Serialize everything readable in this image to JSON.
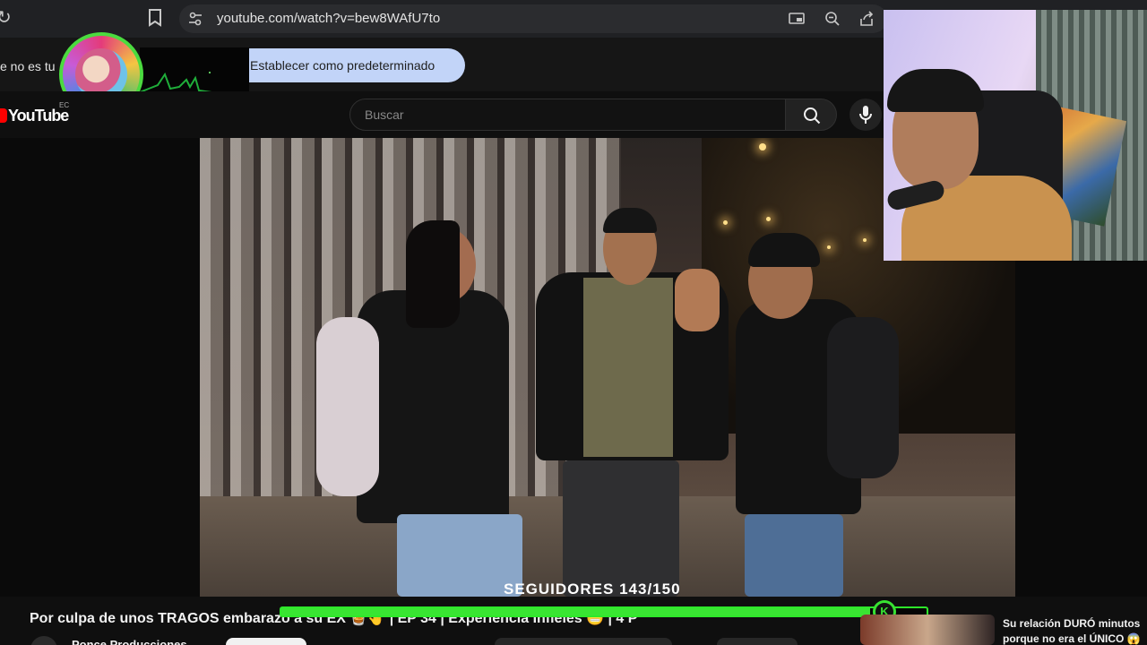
{
  "browser": {
    "url": "youtube.com/watch?v=bew8WAfU7to",
    "icons": [
      "reload-icon",
      "bookmark-icon",
      "tune-icon",
      "cast-icon",
      "zoom-out-icon",
      "share-icon"
    ]
  },
  "notification": {
    "text": "e no es tu",
    "button_label": "Establecer como predeterminado"
  },
  "youtube": {
    "logo_text": "YouTube",
    "country_code": "EC",
    "search_placeholder": "Buscar"
  },
  "video": {
    "overlay_text": "SEGUIDORES 143/150",
    "title": "Por culpa de unos TRAGOS embarazó a su EX 🥃🤚 | EP 34 | Experiencia Infieles 😬 | 4 P",
    "channel_name": "Ponce Producciones",
    "progress": 0.913
  },
  "progress_badge": "K",
  "related": {
    "title_line1": "Su relación DURÓ minutos",
    "title_line2": "porque no era el ÚNICO 😱"
  }
}
